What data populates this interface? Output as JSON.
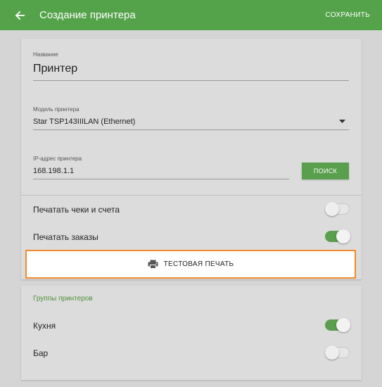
{
  "appbar": {
    "back_icon": "arrow-left-icon",
    "title": "Создание принтера",
    "save_label": "СОХРАНИТЬ"
  },
  "printer": {
    "name_label": "Название",
    "name_value": "Принтер",
    "model_label": "Модель принтера",
    "model_value": "Star TSP143IIILAN (Ethernet)",
    "ip_label": "IP-адрес принтера",
    "ip_value": "168.198.1.1",
    "search_label": "ПОИСК"
  },
  "toggles": {
    "print_receipts": {
      "label": "Печатать чеки и счета",
      "on": false
    },
    "print_orders": {
      "label": "Печатать заказы",
      "on": true
    }
  },
  "test_print": {
    "label": "ТЕСТОВАЯ ПЕЧАТЬ",
    "icon": "printer-icon"
  },
  "groups": {
    "title": "Группы принтеров",
    "items": [
      {
        "label": "Кухня",
        "on": true
      },
      {
        "label": "Бар",
        "on": false
      }
    ]
  },
  "colors": {
    "appbar": "#54a24a",
    "accent": "#5a9f4d",
    "highlight_border": "#f08a2c",
    "background": "#d5d5d5"
  }
}
